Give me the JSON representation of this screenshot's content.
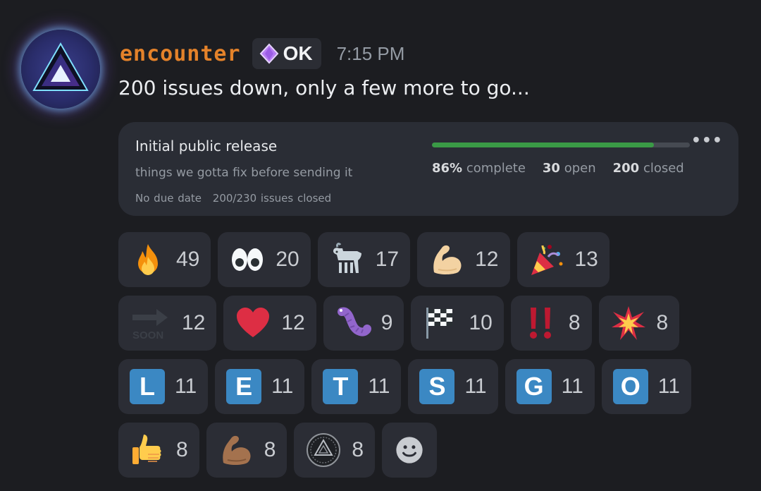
{
  "message": {
    "username": "encounter",
    "tag": "OK",
    "timestamp": "7:15 PM",
    "text": "200 issues down, only a few more to go..."
  },
  "embed": {
    "title": "Initial public release",
    "description": "things we gotta fix before sending it",
    "due": "No due date",
    "issues_closed": "200/230 issues closed",
    "progress_fraction": 0.86,
    "percent": "86%",
    "complete_label": "complete",
    "open_count": "30",
    "open_label": "open",
    "closed_count": "200",
    "closed_label": "closed"
  },
  "reactions": [
    [
      {
        "icon": "fire-icon",
        "count": "49"
      },
      {
        "icon": "eyes-icon",
        "count": "20"
      },
      {
        "icon": "goat-icon",
        "count": "17"
      },
      {
        "icon": "flexed-biceps-light-icon",
        "count": "12"
      },
      {
        "icon": "party-popper-icon",
        "count": "13"
      }
    ],
    [
      {
        "icon": "soon-arrow-icon",
        "count": "12"
      },
      {
        "icon": "red-heart-icon",
        "count": "12"
      },
      {
        "icon": "purple-worm-icon",
        "count": "9"
      },
      {
        "icon": "checkered-flag-icon",
        "count": "10"
      },
      {
        "icon": "double-exclamation-icon",
        "count": "8"
      },
      {
        "icon": "collision-icon",
        "count": "8"
      }
    ],
    [
      {
        "icon": "letter-l-icon",
        "letter": "L",
        "count": "11"
      },
      {
        "icon": "letter-e-icon",
        "letter": "E",
        "count": "11"
      },
      {
        "icon": "letter-t-icon",
        "letter": "T",
        "count": "11"
      },
      {
        "icon": "letter-s-icon",
        "letter": "S",
        "count": "11"
      },
      {
        "icon": "letter-g-icon",
        "letter": "G",
        "count": "11"
      },
      {
        "icon": "letter-o-icon",
        "letter": "O",
        "count": "11"
      }
    ],
    [
      {
        "icon": "thumbs-up-icon",
        "count": "8"
      },
      {
        "icon": "flexed-biceps-dark-icon",
        "count": "8"
      },
      {
        "icon": "triangle-seal-icon",
        "count": "8"
      }
    ]
  ],
  "add_reaction_icon": "smiley-add-reaction-icon",
  "colors": {
    "background": "#1c1d21",
    "username": "#e4822a",
    "progress": "#3a9a46",
    "letter_tile": "#3b88c3"
  }
}
